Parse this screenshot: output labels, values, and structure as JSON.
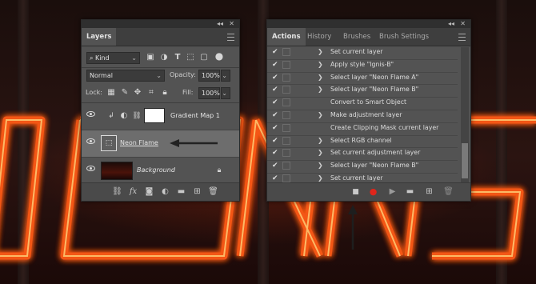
{
  "layers_panel": {
    "tab_label": "Layers",
    "filter_kind": "Kind",
    "blend_mode": "Normal",
    "opacity_label": "Opacity:",
    "opacity_value": "100%",
    "lock_label": "Lock:",
    "fill_label": "Fill:",
    "fill_value": "100%",
    "layers": [
      {
        "name": "Gradient Map 1",
        "selected": false
      },
      {
        "name": "Neon Flame",
        "selected": true
      },
      {
        "name": "Background",
        "selected": false
      }
    ],
    "fx_label": "fx"
  },
  "actions_panel": {
    "tabs": [
      "Actions",
      "History",
      "Brushes",
      "Brush Settings"
    ],
    "items": [
      {
        "label": "Set current layer",
        "expandable": true
      },
      {
        "label": "Apply style \"Ignis-B\"",
        "expandable": true
      },
      {
        "label": "Select layer \"Neon Flame A\"",
        "expandable": true
      },
      {
        "label": "Select layer \"Neon Flame B\"",
        "expandable": true
      },
      {
        "label": "Convert to Smart Object",
        "expandable": false
      },
      {
        "label": "Make adjustment layer",
        "expandable": true
      },
      {
        "label": "Create Clipping Mask current layer",
        "expandable": false
      },
      {
        "label": "Select RGB channel",
        "expandable": true
      },
      {
        "label": "Set current adjustment layer",
        "expandable": true
      },
      {
        "label": "Select layer \"Neon Flame B\"",
        "expandable": true
      },
      {
        "label": "Set current layer",
        "expandable": true
      }
    ]
  },
  "colors": {
    "panel_bg": "#535353",
    "record_red": "#e0251b",
    "neon": "#ff5a10"
  }
}
